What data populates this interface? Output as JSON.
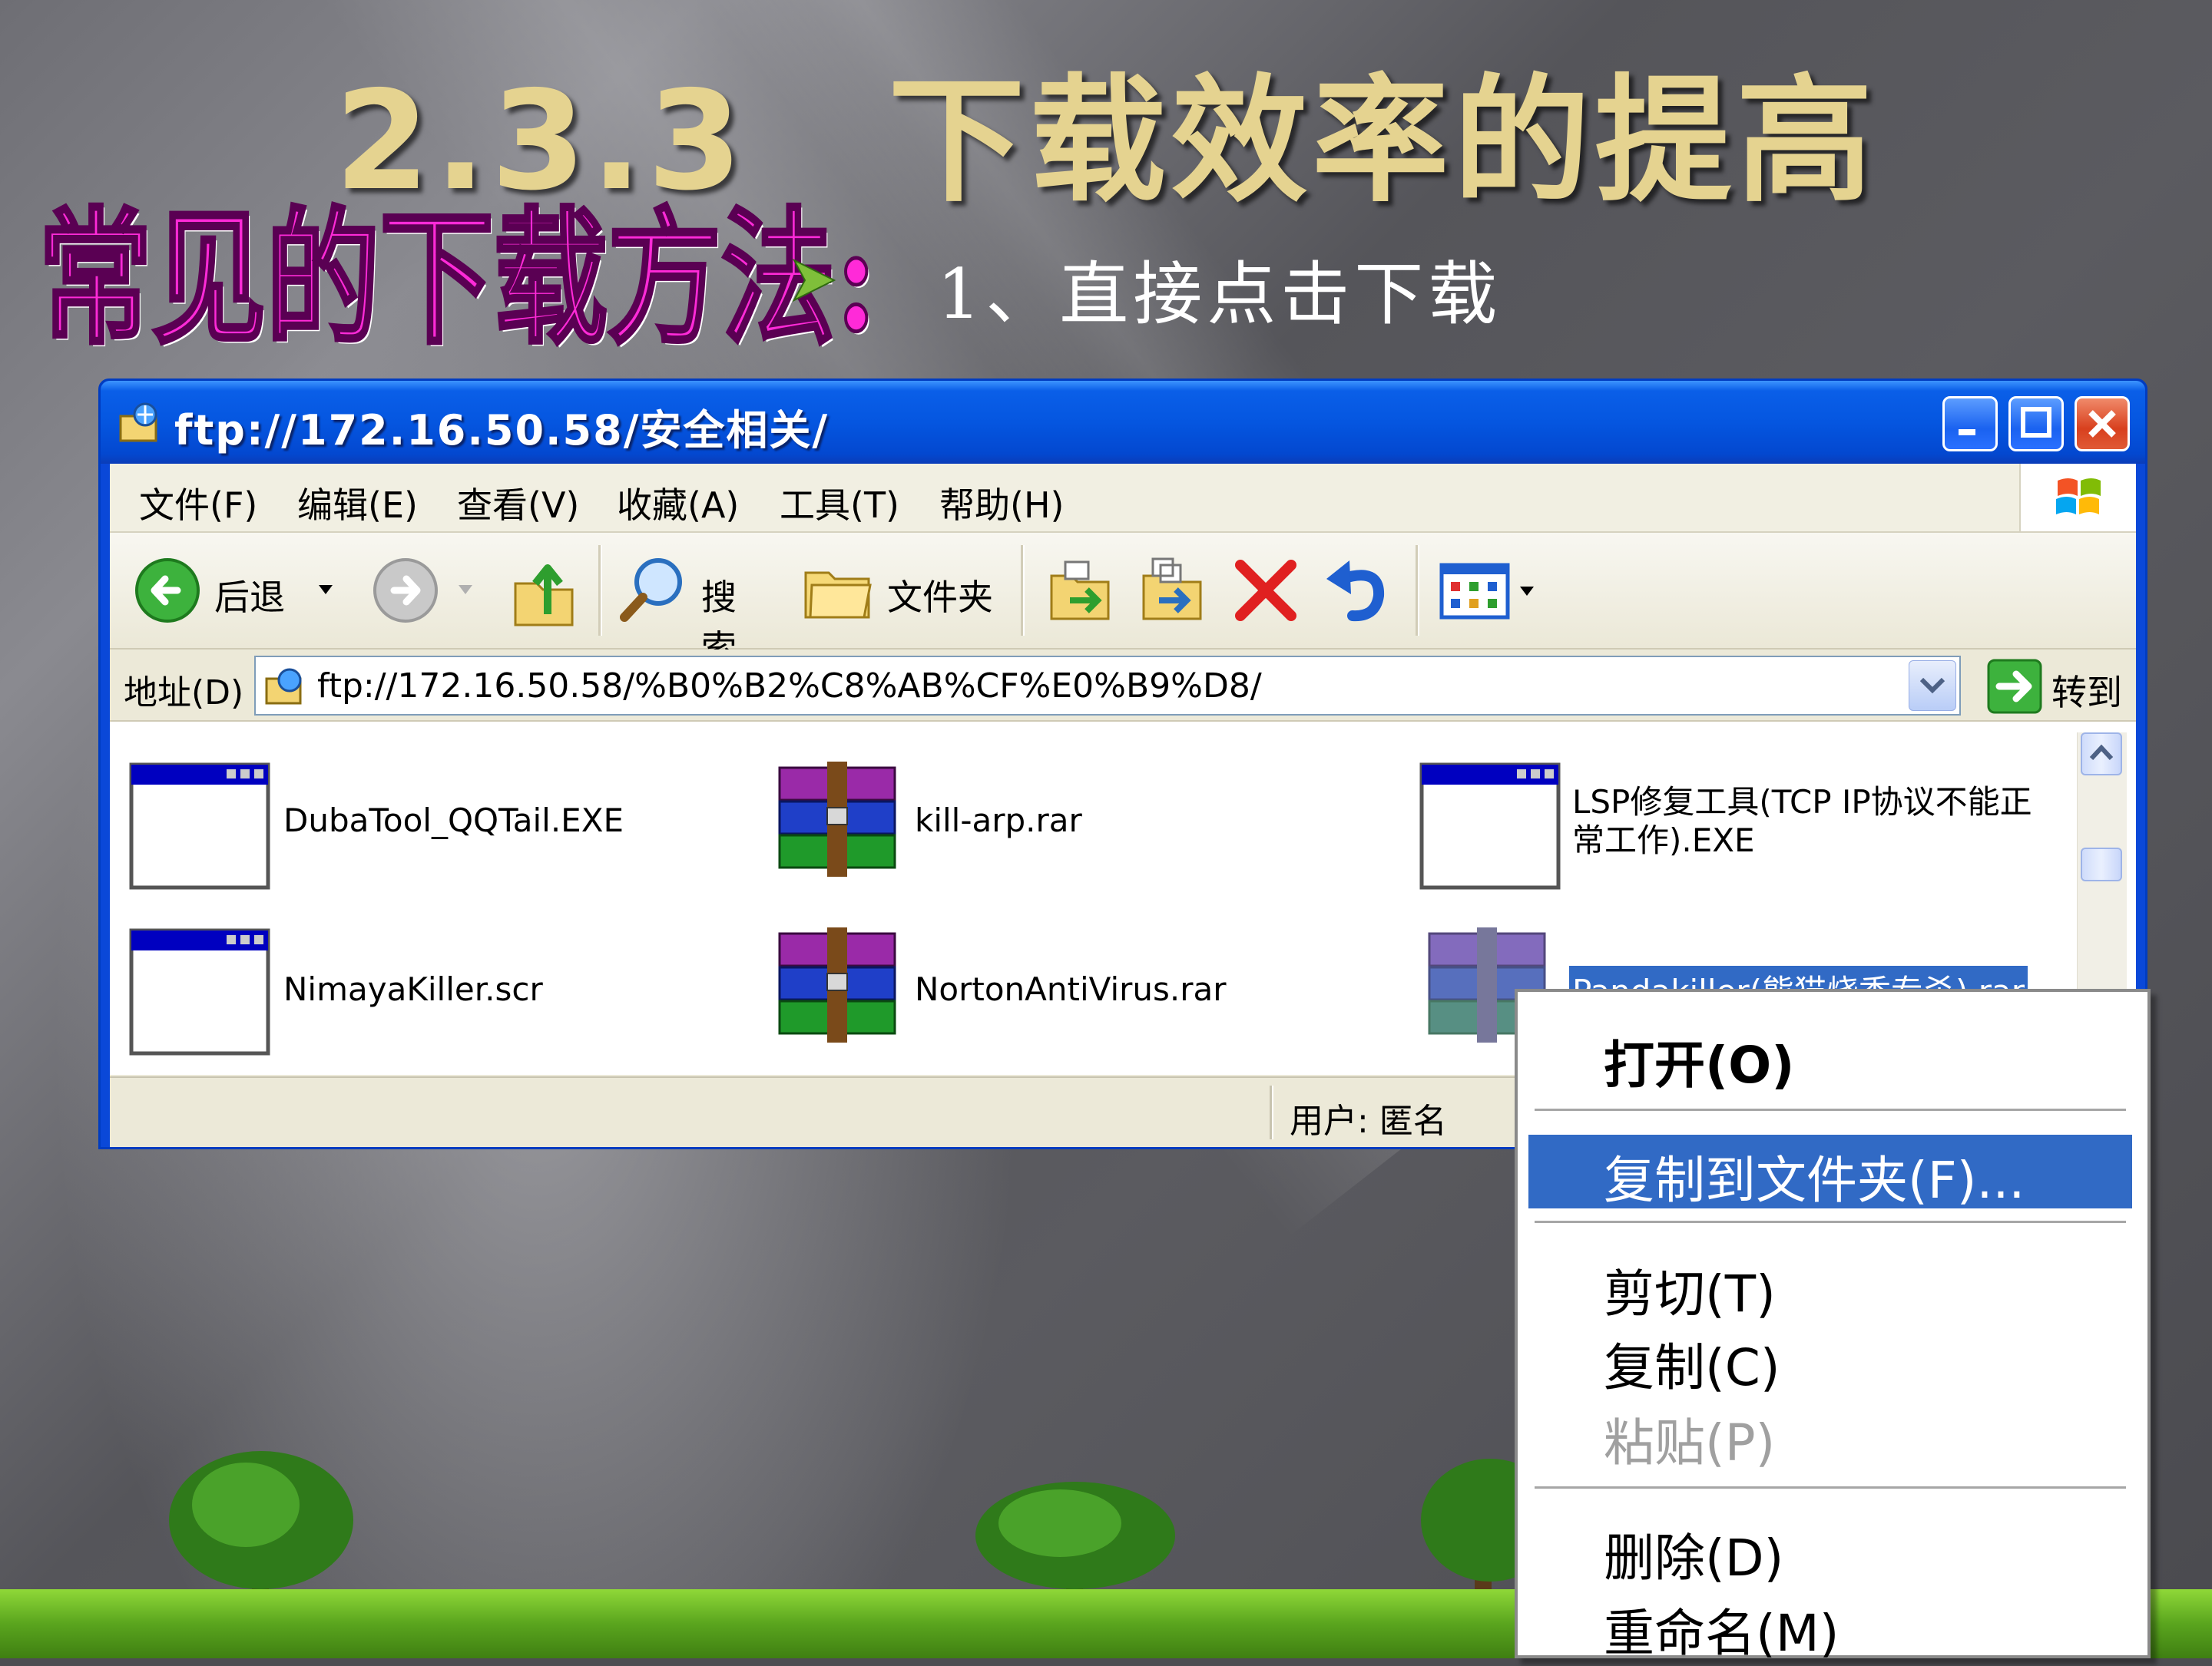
{
  "slide": {
    "title": "2.3.3　下载效率的提高",
    "heading": "常见的下载方法:",
    "bullet": "1、直接点击下载"
  },
  "window": {
    "title": "ftp://172.16.50.58/安全相关/",
    "menu": [
      "文件(F)",
      "编辑(E)",
      "查看(V)",
      "收藏(A)",
      "工具(T)",
      "帮助(H)"
    ],
    "toolbar": {
      "back": "后退",
      "search": "搜索",
      "folders": "文件夹"
    },
    "address": {
      "label": "地址(D)",
      "value": "ftp://172.16.50.58/%B0%B2%C8%AB%CF%E0%B9%D8/",
      "go": "转到"
    },
    "files": [
      {
        "name": "DubaTool_QQTail.EXE",
        "icon": "exe-window-icon"
      },
      {
        "name": "kill-arp.rar",
        "icon": "winrar-archive-icon"
      },
      {
        "name": "LSP修复工具(TCP IP协议不能正常工作).EXE",
        "icon": "exe-window-icon"
      },
      {
        "name": "NimayaKiller.scr",
        "icon": "exe-window-icon"
      },
      {
        "name": "NortonAntiVirus.rar",
        "icon": "winrar-archive-icon"
      },
      {
        "name": "Pandakiller(熊猫烧香专杀).rar",
        "icon": "winrar-archive-icon"
      }
    ],
    "status": "用户: 匿名"
  },
  "context_menu": {
    "open": "打开(O)",
    "copy_to_folder": "复制到文件夹(F)...",
    "cut": "剪切(T)",
    "copy": "复制(C)",
    "paste": "粘贴(P)",
    "delete": "删除(D)",
    "rename": "重命名(M)"
  },
  "colors": {
    "title_gold": "#e5d390",
    "heading_magenta": "#ff2ad8",
    "xp_blue": "#0a48d8",
    "selection_blue": "#316ac5"
  }
}
